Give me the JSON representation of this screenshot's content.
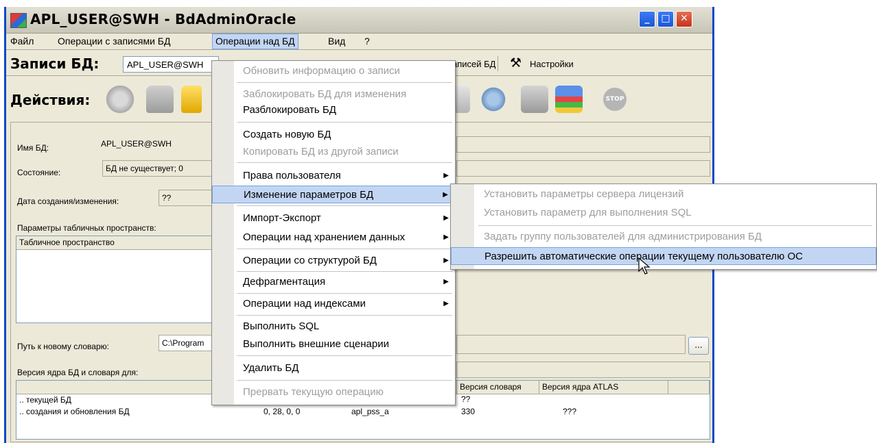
{
  "window": {
    "title": "APL_USER@SWH - BdAdminOracle"
  },
  "menubar": {
    "file": "Файл",
    "records_ops": "Операции с записями БД",
    "db_ops": "Операции над БД",
    "view": "Вид",
    "help": "?"
  },
  "toolbar": {
    "records_label": "Записи БД:",
    "records_combo_value": "APL_USER@SWH",
    "records_tail": "аписей БД",
    "settings_label": "Настройки",
    "actions_label": "Действия:"
  },
  "form": {
    "db_name_label": "Имя БД:",
    "db_name_value": "APL_USER@SWH",
    "state_label": "Состояние:",
    "state_value": "БД не существует; 0",
    "date_label": "Дата создания/изменения:",
    "date_value": "??",
    "tablespace_params_label": "Параметры табличных пространств:",
    "tablespace_column": "Табличное пространство",
    "dict_path_label": "Путь к новому словарю:",
    "dict_path_value": "C:\\Program",
    "ellipsis": "...",
    "version_label": "Версия ядра БД и словаря для:"
  },
  "version_table": {
    "headers": [
      "",
      "",
      "",
      "Версия словаря",
      "Версия ядра ATLAS"
    ],
    "rows": [
      {
        "name": ".. текущей БД",
        "c1": "??",
        "c2": "??",
        "dict": "??",
        "atlas": ""
      },
      {
        "name": ".. создания и обновления БД",
        "c1": "0, 28, 0, 0",
        "c2": "apl_pss_a",
        "dict": "330",
        "atlas": "???"
      }
    ]
  },
  "dropdown": {
    "items": [
      {
        "label": "Обновить информацию о записи",
        "disabled": true
      },
      {
        "label": "Заблокировать БД для изменения",
        "disabled": true
      },
      {
        "label": "Разблокировать БД",
        "disabled": false
      },
      {
        "label": "Создать новую БД",
        "disabled": false
      },
      {
        "label": "Копировать БД из другой записи",
        "disabled": true
      },
      {
        "label": "Права пользователя",
        "disabled": false
      },
      {
        "label": "Изменение параметров БД",
        "disabled": false
      },
      {
        "label": "Импорт-Экспорт",
        "disabled": false
      },
      {
        "label": "Операции над хранением данных",
        "disabled": false
      },
      {
        "label": "Операции со структурой БД",
        "disabled": false
      },
      {
        "label": "Дефрагментация",
        "disabled": false
      },
      {
        "label": "Операции над индексами",
        "disabled": false
      },
      {
        "label": "Выполнить SQL",
        "disabled": false
      },
      {
        "label": "Выполнить внешние сценарии",
        "disabled": false
      },
      {
        "label": "Удалить БД",
        "disabled": false
      },
      {
        "label": "Прервать текущую операцию",
        "disabled": true
      }
    ]
  },
  "submenu": {
    "items": [
      {
        "label": "Установить параметры сервера лицензий",
        "disabled": true
      },
      {
        "label": "Установить параметр для выполнения SQL",
        "disabled": true
      },
      {
        "label": "Задать группу пользователей для администрирования БД",
        "disabled": true
      },
      {
        "label": "Разрешить автоматические операции текущему пользователю ОС",
        "disabled": false
      }
    ]
  },
  "colors": {
    "highlight": "#c2d6f4",
    "disabled_text": "#9d9d9d",
    "title_blue": "#0b48c8"
  }
}
